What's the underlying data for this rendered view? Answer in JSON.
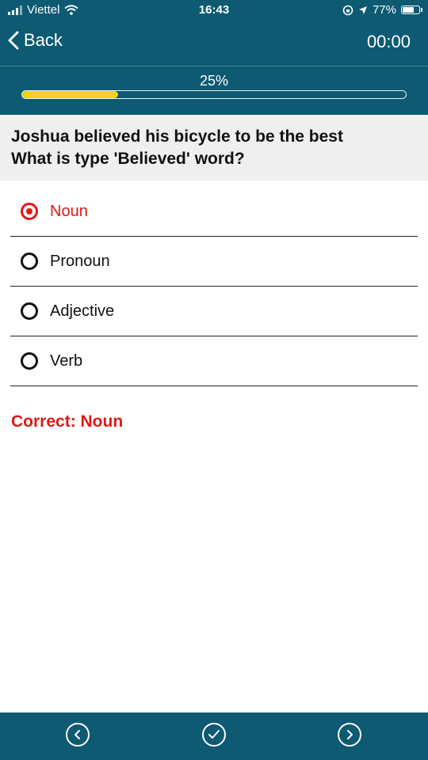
{
  "status_bar": {
    "carrier": "Viettel",
    "time": "16:43",
    "battery": "77%",
    "battery_level": 0.77
  },
  "nav": {
    "back_label": "Back",
    "timer": "00:00"
  },
  "progress": {
    "label": "25%",
    "value": 0.25
  },
  "question": {
    "line1": "Joshua believed his bicycle to be the best",
    "line2": "What is type 'Believed' word?"
  },
  "options": [
    {
      "label": "Noun",
      "selected": true
    },
    {
      "label": "Pronoun",
      "selected": false
    },
    {
      "label": "Adjective",
      "selected": false
    },
    {
      "label": "Verb",
      "selected": false
    }
  ],
  "result": {
    "text": "Correct: Noun"
  },
  "colors": {
    "brand": "#0d5a72",
    "progress_fill": "#f2d21a",
    "accent_red": "#e11818",
    "question_bg": "#efefef"
  },
  "icons": {
    "prev": "chevron-left-circle-icon",
    "check": "check-circle-icon",
    "next": "chevron-right-circle-icon"
  }
}
